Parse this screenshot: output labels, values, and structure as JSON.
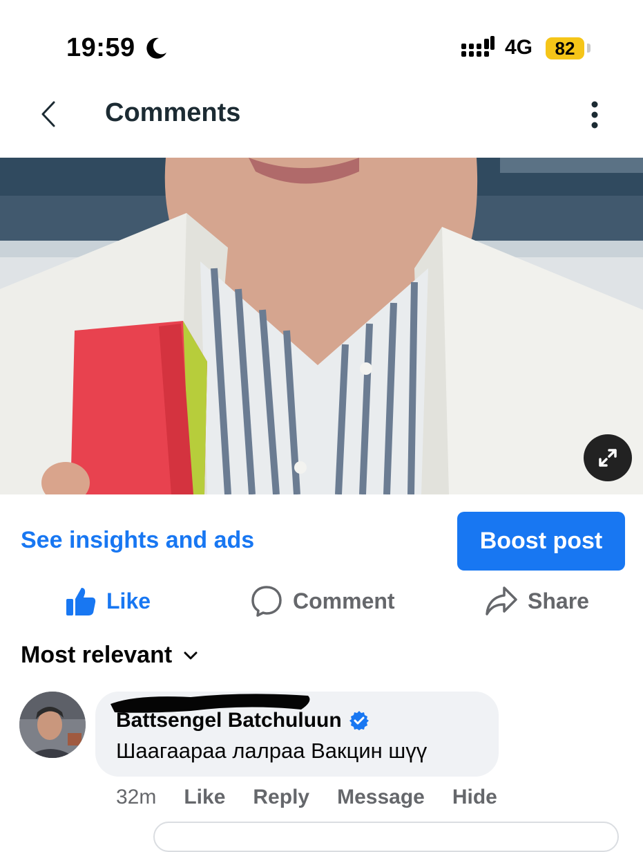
{
  "status_bar": {
    "time": "19:59",
    "network": "4G",
    "battery": "82"
  },
  "header": {
    "title": "Comments"
  },
  "post": {
    "image_alt": "photo",
    "insights_link": "See insights and ads",
    "boost_button": "Boost post"
  },
  "reactions": {
    "like": "Like",
    "comment": "Comment",
    "share": "Share"
  },
  "sort": {
    "label": "Most relevant"
  },
  "comment": {
    "author": "Battsengel Batchuluun",
    "verified": true,
    "text": "Шаагаараа лалраа Вакцин шүү",
    "time": "32m",
    "actions": [
      "Like",
      "Reply",
      "Message",
      "Hide"
    ]
  },
  "colors": {
    "accent": "#1877f2",
    "battery": "#f5c518",
    "muted": "#65676b"
  }
}
